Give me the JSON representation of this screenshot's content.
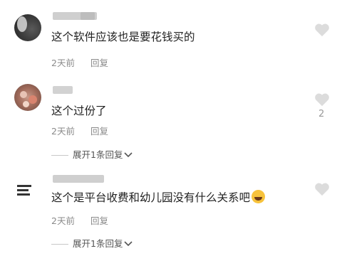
{
  "comments": [
    {
      "text": "这个软件应该也是要花钱买的",
      "time": "2天前",
      "reply": "回复"
    },
    {
      "text": "这个过份了",
      "time": "2天前",
      "reply": "回复",
      "like_count": "2",
      "expand_label": "展开1条回复"
    },
    {
      "text": "这个是平台收费和幼儿园没有什么关系吧",
      "time": "2天前",
      "reply": "回复",
      "expand_label": "展开1条回复"
    }
  ],
  "icons": {
    "like": "heart-icon",
    "expand": "chevron-down-icon",
    "emoji": "laughing-emoji-icon"
  },
  "colors": {
    "text": "#222222",
    "meta": "#8a8a8a",
    "icon": "#dcdcdc"
  }
}
